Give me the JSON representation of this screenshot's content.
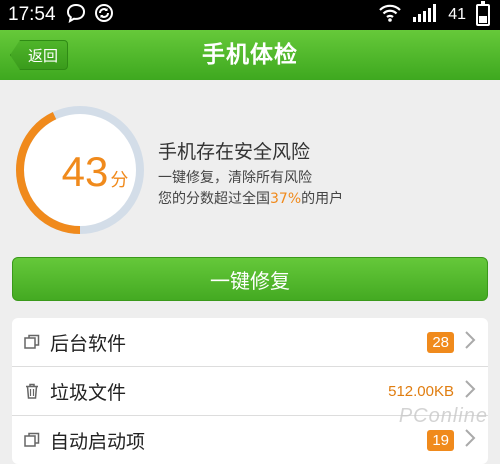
{
  "status_bar": {
    "time": "17:54",
    "battery": "41"
  },
  "header": {
    "back_label": "返回",
    "title": "手机体检"
  },
  "score": {
    "value": "43",
    "unit": "分",
    "progress": 0.43
  },
  "risk": {
    "title": "手机存在安全风险",
    "line1": "一键修复，清除所有风险",
    "line2_prefix": "您的分数超过全国",
    "line2_percent": "37%",
    "line2_suffix": "的用户"
  },
  "fix_button": {
    "label": "一键修复"
  },
  "items": [
    {
      "label": "后台软件",
      "badge": "28",
      "icon": "window-icon"
    },
    {
      "label": "垃圾文件",
      "value": "512.00KB",
      "icon": "trash-icon"
    },
    {
      "label": "自动启动项",
      "badge": "19",
      "icon": "window-icon"
    }
  ],
  "watermark": "PConline",
  "colors": {
    "green": "#44aa22",
    "orange": "#f08a1c",
    "ring_bg": "#d3dde8"
  }
}
